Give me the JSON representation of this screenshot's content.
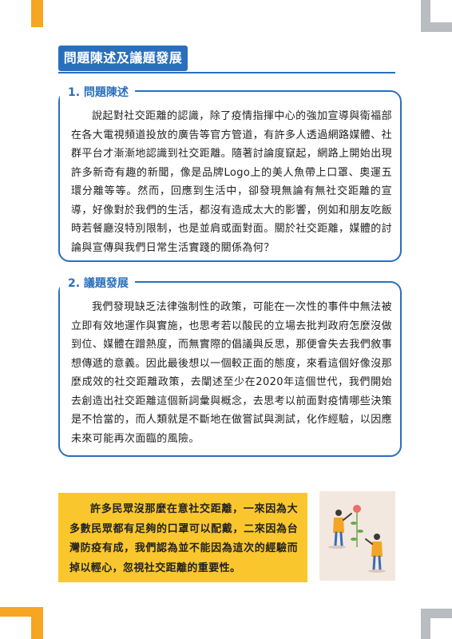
{
  "section_title": "問題陳述及議題發展",
  "problem": {
    "heading": "1. 問題陳述",
    "body": "說起對社交距離的認識，除了疫情指揮中心的強加宣導與衛福部在各大電視頻道投放的廣告等官方管道，有許多人透過網路媒體、社群平台才漸漸地認識到社交距離。隨著討論度竄起，網路上開始出現許多新奇有趣的新聞，像是品牌Logo上的美人魚帶上口罩、奧運五環分離等等。然而，回應到生活中，卻發現無論有無社交距離的宣導，好像對於我們的生活，都沒有造成太大的影響，例如和朋友吃飯時若餐廳沒特別限制，也是並肩或面對面。關於社交距離，媒體的討論與宣傳與我們日常生活實踐的關係為何？"
  },
  "development": {
    "heading": "2. 議題發展",
    "body": "我們發現缺乏法律強制性的政策，可能在一次性的事件中無法被立即有效地運作與實施，也思考若以酸民的立場去批判政府怎麼沒做到位、媒體在蹭熱度，而無實際的倡議與反思，那便會失去我們敘事想傳遞的意義。因此最後想以一個較正面的態度，來看這個好像沒那麼成效的社交距離政策，去闡述至少在2020年這個世代，我們開始去創造出社交距離這個新詞彙與概念，去思考以前面對疫情哪些決策是不恰當的，而人類就是不斷地在做嘗試與測試，化作經驗，以因應未來可能再次面臨的風險。"
  },
  "callout": {
    "text": "許多民眾沒那麼在意社交距離，一來因為大多數民眾都有足夠的口罩可以配戴，二來因為台灣防疫有成，我們認為並不能因為這次的經驗而掉以輕心，忽視社交距離的重要性。"
  },
  "colors": {
    "accent_blue": "#2a6fbd",
    "callout_yellow": "#f9c72d",
    "corner_orange": "#f6a623",
    "corner_gray": "#b9bcc0"
  }
}
